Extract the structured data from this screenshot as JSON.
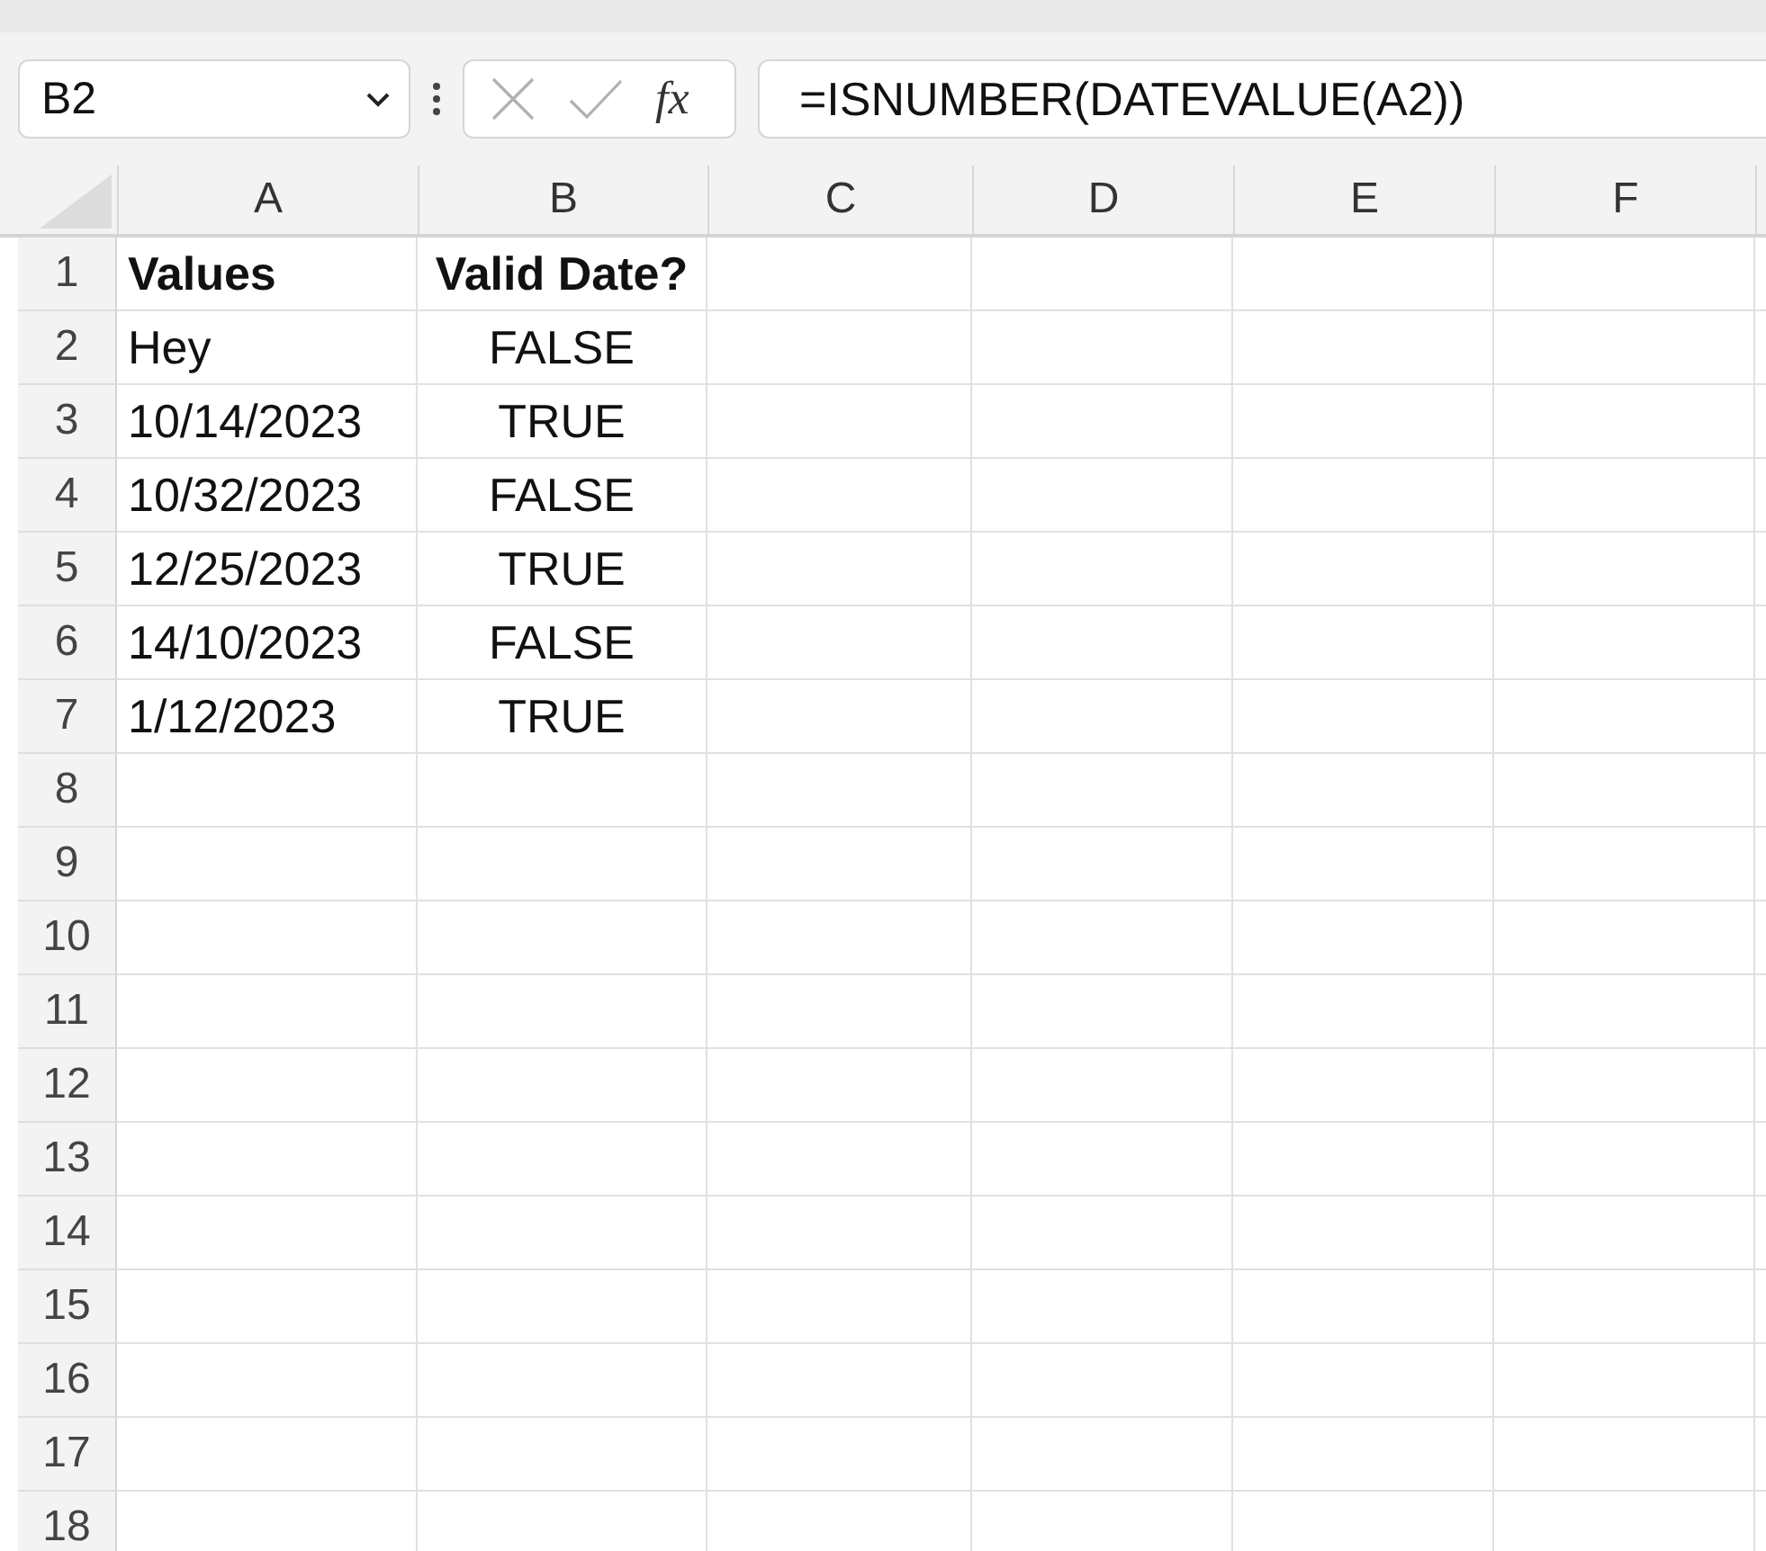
{
  "formula_bar": {
    "name_box": "B2",
    "function_label": "fx",
    "formula": "=ISNUMBER(DATEVALUE(A2))"
  },
  "columns": [
    {
      "label": "A"
    },
    {
      "label": "B"
    },
    {
      "label": "C"
    },
    {
      "label": "D"
    },
    {
      "label": "E"
    },
    {
      "label": "F"
    }
  ],
  "rows": [
    {
      "number": "1",
      "bold": true,
      "cells": [
        "Values",
        "Valid Date?"
      ]
    },
    {
      "number": "2",
      "bold": false,
      "cells": [
        "Hey",
        "FALSE"
      ]
    },
    {
      "number": "3",
      "bold": false,
      "cells": [
        "10/14/2023",
        "TRUE"
      ]
    },
    {
      "number": "4",
      "bold": false,
      "cells": [
        "10/32/2023",
        "FALSE"
      ]
    },
    {
      "number": "5",
      "bold": false,
      "cells": [
        "12/25/2023",
        "TRUE"
      ]
    },
    {
      "number": "6",
      "bold": false,
      "cells": [
        "14/10/2023",
        "FALSE"
      ]
    },
    {
      "number": "7",
      "bold": false,
      "cells": [
        "1/12/2023",
        "TRUE"
      ]
    },
    {
      "number": "8",
      "cells": []
    },
    {
      "number": "9",
      "cells": []
    },
    {
      "number": "10",
      "cells": []
    },
    {
      "number": "11",
      "cells": []
    },
    {
      "number": "12",
      "cells": []
    },
    {
      "number": "13",
      "cells": []
    },
    {
      "number": "14",
      "cells": []
    },
    {
      "number": "15",
      "cells": []
    },
    {
      "number": "16",
      "cells": []
    },
    {
      "number": "17",
      "cells": []
    },
    {
      "number": "18",
      "cells": []
    }
  ]
}
